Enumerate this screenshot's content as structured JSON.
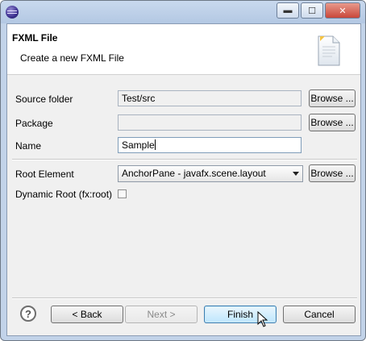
{
  "window": {
    "controls": [
      "minimize",
      "maximize",
      "close"
    ]
  },
  "header": {
    "title": "FXML File",
    "description": "Create a new FXML File"
  },
  "form": {
    "source_folder": {
      "label": "Source folder",
      "value": "Test/src",
      "browse_label": "Browse ..."
    },
    "package": {
      "label": "Package",
      "value": "",
      "browse_label": "Browse ..."
    },
    "name": {
      "label": "Name",
      "value": "Sample"
    },
    "root_element": {
      "label": "Root Element",
      "value": "AnchorPane - javafx.scene.layout",
      "browse_label": "Browse ..."
    },
    "dynamic_root": {
      "label": "Dynamic Root (fx:root)",
      "checked": false
    }
  },
  "footer": {
    "help": "?",
    "back_label": "< Back",
    "next_label": "Next >",
    "finish_label": "Finish",
    "cancel_label": "Cancel"
  },
  "colors": {
    "frame": "#c2d3e9",
    "client": "#f0f0f0",
    "default_button": "#bee6fd"
  }
}
